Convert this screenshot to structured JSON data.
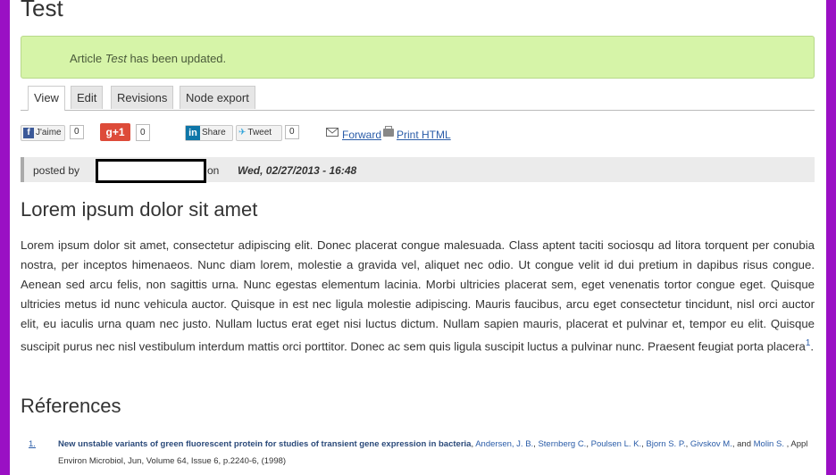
{
  "page": {
    "title": "Test"
  },
  "status": {
    "prefix": "Article ",
    "article": "Test",
    "suffix": " has been updated."
  },
  "tabs": [
    {
      "label": "View"
    },
    {
      "label": "Edit"
    },
    {
      "label": "Revisions"
    },
    {
      "label": "Node export"
    }
  ],
  "social": {
    "fb_label": "J'aime",
    "fb_count": "0",
    "gplus_label": "+1",
    "gplus_count": "0",
    "linkedin_label": "Share",
    "tweet_label": "Tweet",
    "tweet_count": "0",
    "forward": "Forward",
    "print_html": "Print HTML"
  },
  "meta": {
    "posted_by": "posted by",
    "on": "on",
    "date": "Wed, 02/27/2013 - 16:48"
  },
  "article": {
    "heading": "Lorem ipsum dolor sit amet",
    "body": "Lorem ipsum dolor sit amet, consectetur adipiscing elit. Donec placerat congue malesuada. Class aptent taciti sociosqu ad litora torquent per conubia nostra, per inceptos himenaeos. Nunc diam lorem, molestie a gravida vel, aliquet nec odio. Ut congue velit id dui pretium in dapibus risus congue. Aenean sed arcu felis, non sagittis urna. Nunc egestas elementum lacinia. Morbi ultricies placerat sem, eget venenatis tortor congue eget. Quisque ultricies metus id nunc vehicula auctor. Quisque in est nec ligula molestie adipiscing. Mauris faucibus, arcu eget consectetur tincidunt, nisl orci auctor elit, eu iaculis urna quam nec justo. Nullam luctus erat eget nisi luctus dictum. Nullam sapien mauris, placerat et pulvinar et, tempor eu elit. Quisque suscipit purus nec nisl vestibulum interdum mattis orci porttitor. Donec ac sem quis ligula suscipit luctus a pulvinar nunc. Praesent feugiat porta placera",
    "footnote": "1",
    "after_footnote": "."
  },
  "references": {
    "heading": "Réferences",
    "items": [
      {
        "num": "1.",
        "title": "New unstable variants of green fluorescent protein for studies of transient gene expression in bacteria",
        "authors": [
          "Andersen, J. B.",
          "Sternberg C.",
          "Poulsen L. K.",
          "Bjorn S. P.",
          "Givskov M.",
          "Molin S."
        ],
        "citation": " , Appl Environ Microbiol, Jun, Volume 64, Issue 6, p.2240-6, (1998)"
      }
    ]
  },
  "colors": {
    "frame": "#9a10c4",
    "status_bg": "#d6f4a8",
    "link": "#2a5ca8"
  }
}
